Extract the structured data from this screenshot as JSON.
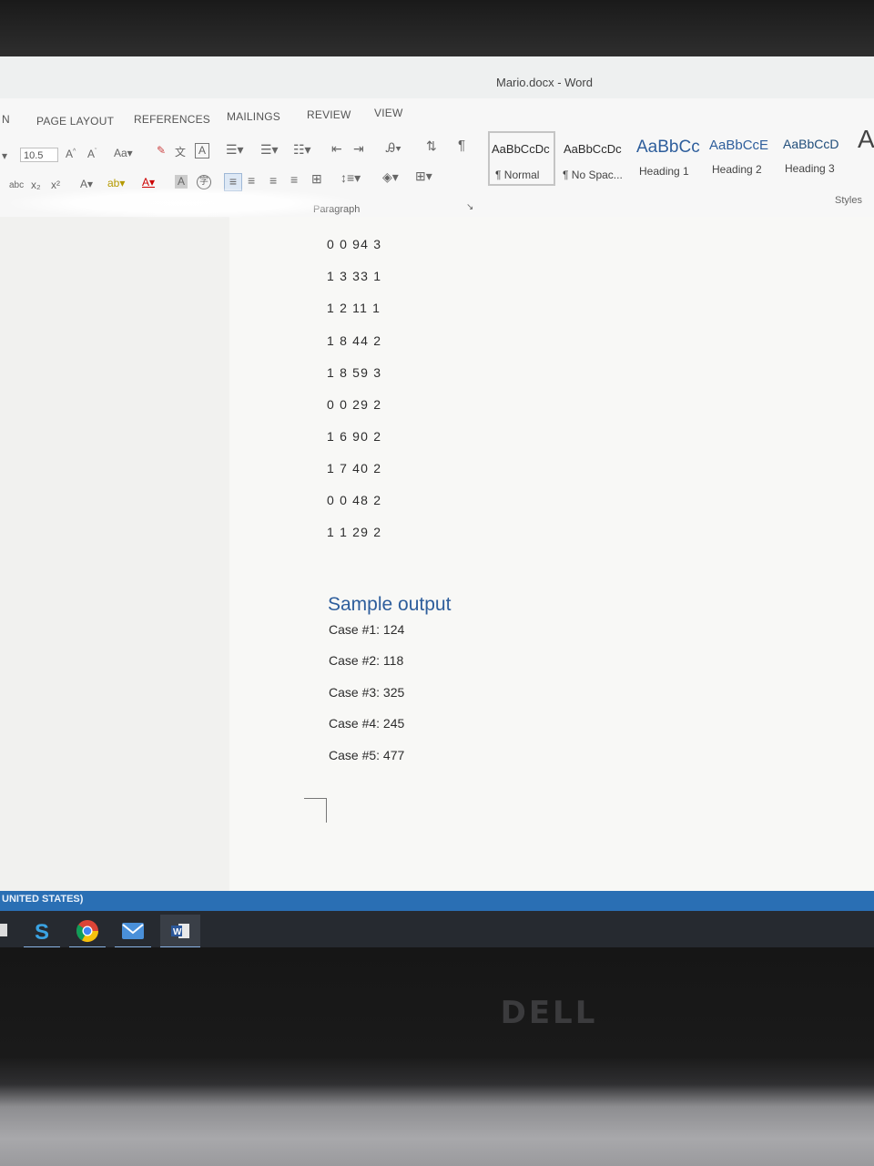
{
  "window": {
    "title": "Mario.docx - Word"
  },
  "ribbon": {
    "tabs": [
      "N",
      "PAGE LAYOUT",
      "REFERENCES",
      "MAILINGS",
      "REVIEW",
      "VIEW"
    ],
    "font_size": "10.5",
    "paragraph_group_label": "Paragraph",
    "styles_group_label": "Styles",
    "styles": [
      {
        "sample": "AaBbCcDc",
        "name": "¶ Normal"
      },
      {
        "sample": "AaBbCcDc",
        "name": "¶ No Spac..."
      },
      {
        "sample": "AaBbCc",
        "name": "Heading 1"
      },
      {
        "sample": "AaBbCcE",
        "name": "Heading 2"
      },
      {
        "sample": "AaBbCcD",
        "name": "Heading 3"
      }
    ]
  },
  "document": {
    "input_lines": [
      "0 0 94 3",
      "1 3 33 1",
      "1 2 11 1",
      "1 8 44 2",
      "1 8 59 3",
      "0 0 29 2",
      "1 6 90 2",
      "1 7 40 2",
      "0 0 48 2",
      "1 1 29 2"
    ],
    "heading": "Sample output",
    "output_lines": [
      "Case #1: 124",
      "Case #2: 118",
      "Case #3: 325",
      "Case #4: 245",
      "Case #5: 477"
    ]
  },
  "status_bar": {
    "language": "UNITED STATES)"
  },
  "taskbar": {
    "icons": [
      "skype-icon",
      "chrome-icon",
      "mail-icon",
      "word-icon"
    ]
  },
  "hardware": {
    "logo": "DELL"
  }
}
